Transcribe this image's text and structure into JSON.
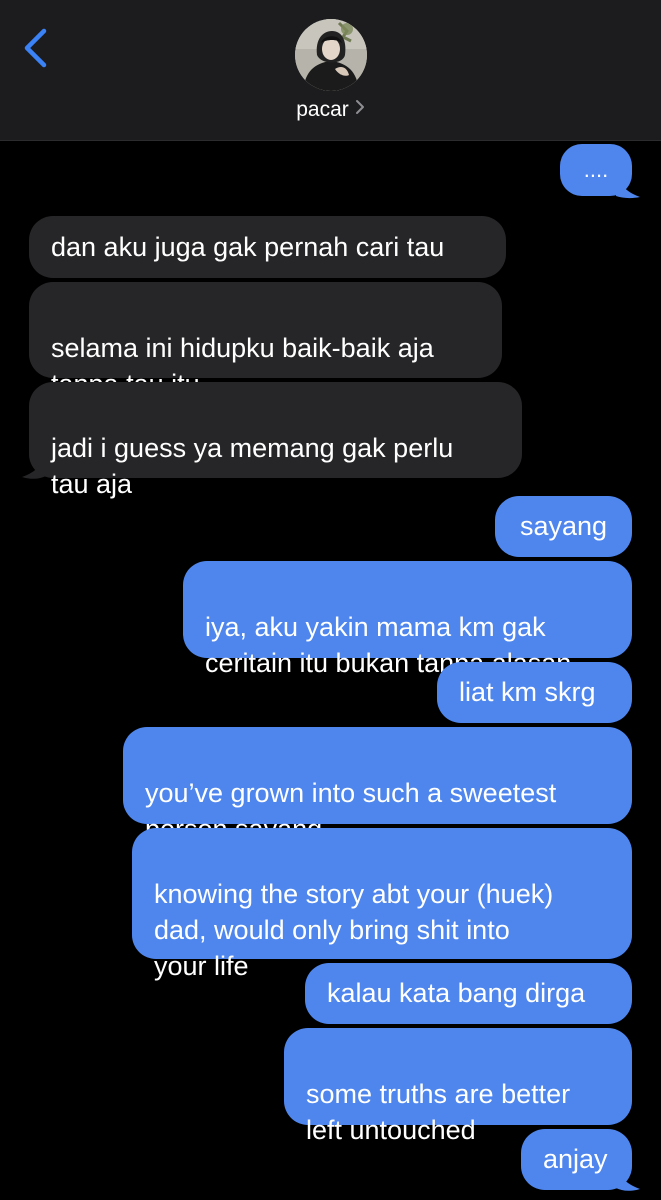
{
  "header": {
    "contact_name": "pacar",
    "back_icon": "chevron-left-icon",
    "name_chevron_icon": "chevron-right-icon"
  },
  "colors": {
    "incoming_bubble": "#262628",
    "outgoing_bubble": "#4e86ee",
    "accent": "#3a82f6",
    "header_background": "#1c1c1e"
  },
  "messages": [
    {
      "direction": "outgoing",
      "text": "...."
    },
    {
      "direction": "incoming",
      "text": "dan aku juga gak pernah cari tau"
    },
    {
      "direction": "incoming",
      "text": "selama ini hidupku baik-baik aja\ntanpa tau itu"
    },
    {
      "direction": "incoming",
      "text": "jadi i guess ya memang gak perlu\ntau aja"
    },
    {
      "direction": "outgoing",
      "text": "sayang"
    },
    {
      "direction": "outgoing",
      "text": "iya, aku yakin mama km gak\nceritain itu bukan tanpa alasan"
    },
    {
      "direction": "outgoing",
      "text": "liat km skrg"
    },
    {
      "direction": "outgoing",
      "text": "you’ve grown into such a sweetest\nperson sayang"
    },
    {
      "direction": "outgoing",
      "text": "knowing the story abt your (huek)\ndad, would only bring shit into\nyour life"
    },
    {
      "direction": "outgoing",
      "text": "kalau kata bang dirga"
    },
    {
      "direction": "outgoing",
      "text": "some truths are better\nleft untouched"
    },
    {
      "direction": "outgoing",
      "text": "anjay"
    }
  ]
}
